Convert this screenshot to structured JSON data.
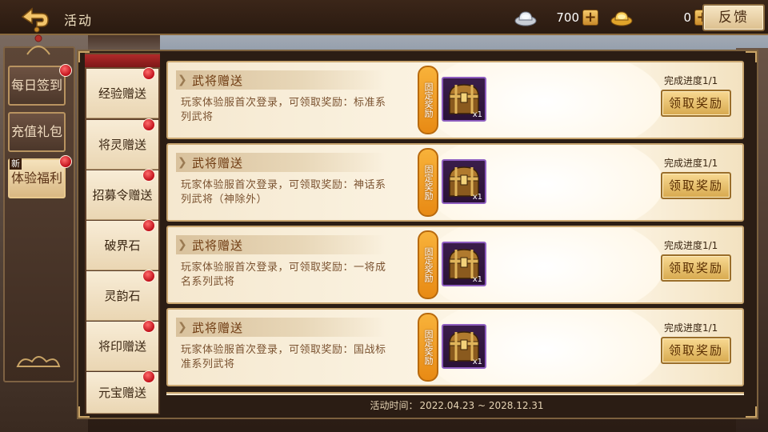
{
  "header": {
    "title": "活动",
    "silver_value": "700",
    "gold_value": "0",
    "feedback_label": "反馈"
  },
  "left_tabs": [
    {
      "label": "每日签到",
      "has_dot": true,
      "active": false
    },
    {
      "label": "充值礼包",
      "has_dot": false,
      "active": false
    },
    {
      "label": "体验福利",
      "has_dot": true,
      "active": true,
      "tag": "新"
    }
  ],
  "sub_tabs": [
    {
      "label": "经验赠送"
    },
    {
      "label": "将灵赠送"
    },
    {
      "label": "招募令赠送"
    },
    {
      "label": "破界石"
    },
    {
      "label": "灵韵石"
    },
    {
      "label": "将印赠送"
    },
    {
      "label": "元宝赠送"
    }
  ],
  "cards": [
    {
      "title": "武将赠送",
      "desc": "玩家体验服首次登录，可领取奖励：标准系列武将",
      "badge": "固定奖励",
      "reward_count": "x1",
      "progress": "完成进度1/1",
      "button": "领取奖励"
    },
    {
      "title": "武将赠送",
      "desc": "玩家体验服首次登录，可领取奖励：神话系列武将（神除外）",
      "badge": "固定奖励",
      "reward_count": "x1",
      "progress": "完成进度1/1",
      "button": "领取奖励"
    },
    {
      "title": "武将赠送",
      "desc": "玩家体验服首次登录，可领取奖励：一将成名系列武将",
      "badge": "固定奖励",
      "reward_count": "x1",
      "progress": "完成进度1/1",
      "button": "领取奖励"
    },
    {
      "title": "武将赠送",
      "desc": "玩家体验服首次登录，可领取奖励：国战标准系列武将",
      "badge": "固定奖励",
      "reward_count": "x1",
      "progress": "完成进度1/1",
      "button": "领取奖励"
    }
  ],
  "footer": {
    "time_prefix": "活动时间：",
    "time_range": "2022.04.23 ~ 2028.12.31"
  },
  "colors": {
    "accent_gold": "#d7a94e",
    "red_dot": "#c0101a",
    "card_bg": "#fbf3e2",
    "frame_brown": "#7c613e"
  },
  "icons": {
    "back": "back-arrow-icon",
    "silver": "silver-ingot-icon",
    "gold": "gold-ingot-icon",
    "reward": "treasure-chest-icon"
  }
}
